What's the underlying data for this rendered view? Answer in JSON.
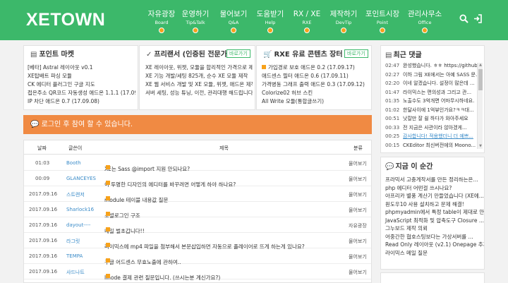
{
  "logo": "XETOWN",
  "nav": [
    {
      "label": "자유광장",
      "sub": "Board"
    },
    {
      "label": "운영하기",
      "sub": "Tip&Talk"
    },
    {
      "label": "물어보기",
      "sub": "Q&A"
    },
    {
      "label": "도움받기",
      "sub": "Help"
    },
    {
      "label": "RX / XE",
      "sub": "RXE"
    },
    {
      "label": "제작하기",
      "sub": "DevTip"
    },
    {
      "label": "포인트시장",
      "sub": "Point"
    },
    {
      "label": "관리사무소",
      "sub": "Office"
    }
  ],
  "icons": {
    "search": "search-icon",
    "login": "sign-in-icon"
  },
  "colors": {
    "brand": "#3cb86a",
    "accent": "#f08a43",
    "badge": "#f7a21b",
    "link": "#3a8bc8"
  },
  "point_market": {
    "title": "포인트 마켓",
    "items": [
      "[베타] Astral 레이아웃 v0.1",
      "XE탑배트 파싱 모듈",
      "CK 에디터 플러그인 구글 지도",
      "접은주소 QR코드 자동생성 애드온 1.1.1 (17.09.17)",
      "IP 차단 애드온 0.7 (17.09.08)"
    ]
  },
  "freelancer": {
    "title": "프리랜서 (인증된 전문가)",
    "more": "바로가기",
    "items": [
      "XE 레이아웃, 위젯, 모듈을 합리적인 가격으로 제작합니다",
      "XE 기능 개발/세팅 825개, 순수 XE 모듈 제작",
      "XE 웹 서비스 개발 및 XE 모듈, 위젯, 애드온 제작",
      "서버 세팅, 성능 튜닝, 이전, 관리대행 해드립니다"
    ]
  },
  "rxe_store": {
    "title": "RXE 유료 콘텐츠 장터",
    "more": "바로가기",
    "items": [
      "가입경로 보호 애드온 0.2 (17.09.17)",
      "애드센스 필터 애드온 0.6 (17.09.11)",
      "가격병동 그래프 출력 애드온 0.3 (17.09.12)",
      "Colorize02 허브 스킨",
      "All Write 모듈(통합글쓰기)"
    ]
  },
  "login_notice": "로그인 후 참여 할 수 있습니다.",
  "board": {
    "headers": {
      "date": "날짜",
      "author": "글쓴이",
      "title": "제목",
      "category": "분류"
    },
    "rows": [
      {
        "date": "01:03",
        "author": "Booth",
        "title": "XE는 Sass @import 지원 안되나요?",
        "count": "2",
        "category": "물어보기"
      },
      {
        "date": "00:09",
        "author": "GLANCEYES",
        "title": "이 투명한 디자인의 에디터를 바꾸려면 어떻게 하야 하나요?",
        "count": "2",
        "category": "물어보기"
      },
      {
        "date": "2017.09.16",
        "author": "스트렌저",
        "title": "module 테이블 내용값 질문",
        "count": "2",
        "category": "물어보기"
      },
      {
        "date": "2017.09.16",
        "author": "Sharlock16",
        "title": "소셜로그인 구조",
        "count": "6",
        "category": "물어보기"
      },
      {
        "date": "2017.09.16",
        "author": "dayout----",
        "title": "내일 벌초갑니다!!",
        "count": "9",
        "category": "자유광장"
      },
      {
        "date": "2017.09.16",
        "author": "라그릿",
        "title": "라이믹스에 mp4 파일을 첨부해서 본문삽입하면 자동으로 플레이어로 뜨게 하는게 있나요?",
        "count": "1",
        "category": "물어보기"
      },
      {
        "date": "2017.09.16",
        "author": "TEMPA",
        "title": "구글 어드센스 무효노출에 관하여..",
        "count": "6",
        "category": "물어보기"
      },
      {
        "date": "2017.09.16",
        "author": "샤드나트",
        "title": "linode 결제 관련 질문입니다. (쓰시는분 계신가요?)",
        "count": "4",
        "category": "물어보기"
      },
      {
        "date": "2017.09.16",
        "author": "Booth",
        "title": "알림센터 스킨 버그... 이거 왜 이럴까요?",
        "count": "4",
        "category": "물어보기"
      }
    ]
  },
  "recent_comments": {
    "title": "최근 댓글",
    "items": [
      {
        "time": "02:47",
        "text": "완성했습니다. ㅎㅎ https://github..."
      },
      {
        "time": "02:27",
        "text": "이하 그림 XE에서는 아예 SASS 문..."
      },
      {
        "time": "02:20",
        "text": "이네 알겠습니다. 설정이 많은데 ..."
      },
      {
        "time": "01:47",
        "text": "라이믹스는 편의성과 그리고 관..."
      },
      {
        "time": "01:35",
        "text": "노출수도 3억개면 어마무시하네요."
      },
      {
        "time": "01:02",
        "text": "한달사이에 1억뷰인가요?ㅋㅋ대..."
      },
      {
        "time": "00:51",
        "text": "낫칼만 잘 쉴 하다가 와아주세요"
      },
      {
        "time": "00:33",
        "text": "전 지금은 사관이라 않아겠게..."
      },
      {
        "time": "00:25",
        "text": "감사합니다! 적용했더니 더 예쁘..."
      },
      {
        "time": "00:15",
        "text": "CKEditor 최신버전에의 Moono..."
      }
    ]
  },
  "hot_now": {
    "title": "지금 이 순간",
    "items": [
      "프라믹서 고충게작서를 만든 정리하는은...",
      "php 에디터 어떤걸 쓰시나요?",
      "아프리카 별풍 계산기 만들었습니다 (XE에...",
      "원도우10 사용 설치하고 문제 해결!",
      "phpmyadmin에서 특정 table이 제대로 안...",
      "JavaScript 최적화 및 압축도구 Closure ...",
      "그누보드 제작 의뢰",
      "어중간한 협호스팅보다는 가상서버를 ...",
      "Read Only 레이아웃 (v2.1) Onepage 추가",
      "라이믹스 메일 질문"
    ]
  }
}
